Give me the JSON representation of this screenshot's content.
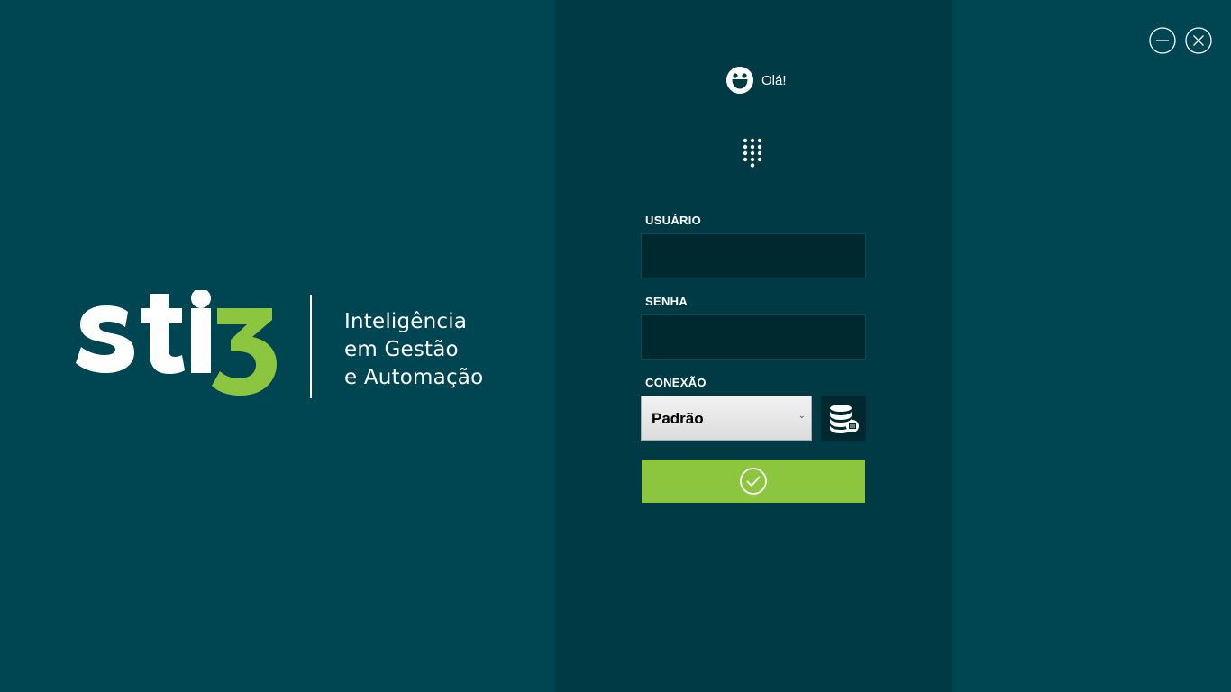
{
  "brand": {
    "logo_text": "sti3",
    "tagline": [
      "Inteligência",
      "em Gestão",
      "e Automação"
    ],
    "accent_color": "#8cc63f"
  },
  "window_controls": {
    "minimize_icon": "minimize-circle-icon",
    "close_icon": "close-circle-icon"
  },
  "login": {
    "greeting": "Olá!",
    "greeting_icon": "smiley-icon",
    "keypad_icon": "keypad-icon",
    "user_label": "USUÁRIO",
    "user_value": "",
    "password_label": "SENHA",
    "password_value": "",
    "connection_label": "CONEXÃO",
    "connection_selected": "Padrão",
    "database_icon": "database-settings-icon",
    "submit_icon": "check-circle-icon"
  },
  "colors": {
    "background": "#004552",
    "panel": "#003a44",
    "field": "#00282f",
    "submit": "#8cc63f"
  }
}
